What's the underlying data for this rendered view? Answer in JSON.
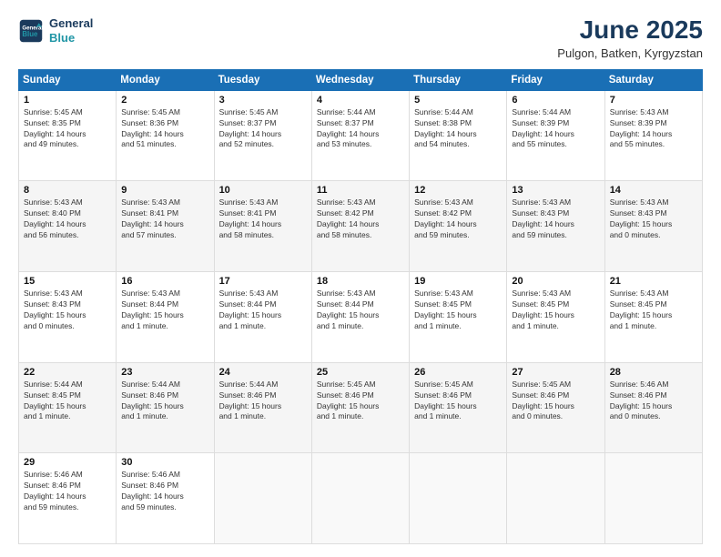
{
  "header": {
    "logo_line1": "General",
    "logo_line2": "Blue",
    "month": "June 2025",
    "location": "Pulgon, Batken, Kyrgyzstan"
  },
  "weekdays": [
    "Sunday",
    "Monday",
    "Tuesday",
    "Wednesday",
    "Thursday",
    "Friday",
    "Saturday"
  ],
  "weeks": [
    [
      {
        "day": "1",
        "info": "Sunrise: 5:45 AM\nSunset: 8:35 PM\nDaylight: 14 hours\nand 49 minutes."
      },
      {
        "day": "2",
        "info": "Sunrise: 5:45 AM\nSunset: 8:36 PM\nDaylight: 14 hours\nand 51 minutes."
      },
      {
        "day": "3",
        "info": "Sunrise: 5:45 AM\nSunset: 8:37 PM\nDaylight: 14 hours\nand 52 minutes."
      },
      {
        "day": "4",
        "info": "Sunrise: 5:44 AM\nSunset: 8:37 PM\nDaylight: 14 hours\nand 53 minutes."
      },
      {
        "day": "5",
        "info": "Sunrise: 5:44 AM\nSunset: 8:38 PM\nDaylight: 14 hours\nand 54 minutes."
      },
      {
        "day": "6",
        "info": "Sunrise: 5:44 AM\nSunset: 8:39 PM\nDaylight: 14 hours\nand 55 minutes."
      },
      {
        "day": "7",
        "info": "Sunrise: 5:43 AM\nSunset: 8:39 PM\nDaylight: 14 hours\nand 55 minutes."
      }
    ],
    [
      {
        "day": "8",
        "info": "Sunrise: 5:43 AM\nSunset: 8:40 PM\nDaylight: 14 hours\nand 56 minutes."
      },
      {
        "day": "9",
        "info": "Sunrise: 5:43 AM\nSunset: 8:41 PM\nDaylight: 14 hours\nand 57 minutes."
      },
      {
        "day": "10",
        "info": "Sunrise: 5:43 AM\nSunset: 8:41 PM\nDaylight: 14 hours\nand 58 minutes."
      },
      {
        "day": "11",
        "info": "Sunrise: 5:43 AM\nSunset: 8:42 PM\nDaylight: 14 hours\nand 58 minutes."
      },
      {
        "day": "12",
        "info": "Sunrise: 5:43 AM\nSunset: 8:42 PM\nDaylight: 14 hours\nand 59 minutes."
      },
      {
        "day": "13",
        "info": "Sunrise: 5:43 AM\nSunset: 8:43 PM\nDaylight: 14 hours\nand 59 minutes."
      },
      {
        "day": "14",
        "info": "Sunrise: 5:43 AM\nSunset: 8:43 PM\nDaylight: 15 hours\nand 0 minutes."
      }
    ],
    [
      {
        "day": "15",
        "info": "Sunrise: 5:43 AM\nSunset: 8:43 PM\nDaylight: 15 hours\nand 0 minutes."
      },
      {
        "day": "16",
        "info": "Sunrise: 5:43 AM\nSunset: 8:44 PM\nDaylight: 15 hours\nand 1 minute."
      },
      {
        "day": "17",
        "info": "Sunrise: 5:43 AM\nSunset: 8:44 PM\nDaylight: 15 hours\nand 1 minute."
      },
      {
        "day": "18",
        "info": "Sunrise: 5:43 AM\nSunset: 8:44 PM\nDaylight: 15 hours\nand 1 minute."
      },
      {
        "day": "19",
        "info": "Sunrise: 5:43 AM\nSunset: 8:45 PM\nDaylight: 15 hours\nand 1 minute."
      },
      {
        "day": "20",
        "info": "Sunrise: 5:43 AM\nSunset: 8:45 PM\nDaylight: 15 hours\nand 1 minute."
      },
      {
        "day": "21",
        "info": "Sunrise: 5:43 AM\nSunset: 8:45 PM\nDaylight: 15 hours\nand 1 minute."
      }
    ],
    [
      {
        "day": "22",
        "info": "Sunrise: 5:44 AM\nSunset: 8:45 PM\nDaylight: 15 hours\nand 1 minute."
      },
      {
        "day": "23",
        "info": "Sunrise: 5:44 AM\nSunset: 8:46 PM\nDaylight: 15 hours\nand 1 minute."
      },
      {
        "day": "24",
        "info": "Sunrise: 5:44 AM\nSunset: 8:46 PM\nDaylight: 15 hours\nand 1 minute."
      },
      {
        "day": "25",
        "info": "Sunrise: 5:45 AM\nSunset: 8:46 PM\nDaylight: 15 hours\nand 1 minute."
      },
      {
        "day": "26",
        "info": "Sunrise: 5:45 AM\nSunset: 8:46 PM\nDaylight: 15 hours\nand 1 minute."
      },
      {
        "day": "27",
        "info": "Sunrise: 5:45 AM\nSunset: 8:46 PM\nDaylight: 15 hours\nand 0 minutes."
      },
      {
        "day": "28",
        "info": "Sunrise: 5:46 AM\nSunset: 8:46 PM\nDaylight: 15 hours\nand 0 minutes."
      }
    ],
    [
      {
        "day": "29",
        "info": "Sunrise: 5:46 AM\nSunset: 8:46 PM\nDaylight: 14 hours\nand 59 minutes."
      },
      {
        "day": "30",
        "info": "Sunrise: 5:46 AM\nSunset: 8:46 PM\nDaylight: 14 hours\nand 59 minutes."
      },
      {
        "day": "",
        "info": ""
      },
      {
        "day": "",
        "info": ""
      },
      {
        "day": "",
        "info": ""
      },
      {
        "day": "",
        "info": ""
      },
      {
        "day": "",
        "info": ""
      }
    ]
  ]
}
